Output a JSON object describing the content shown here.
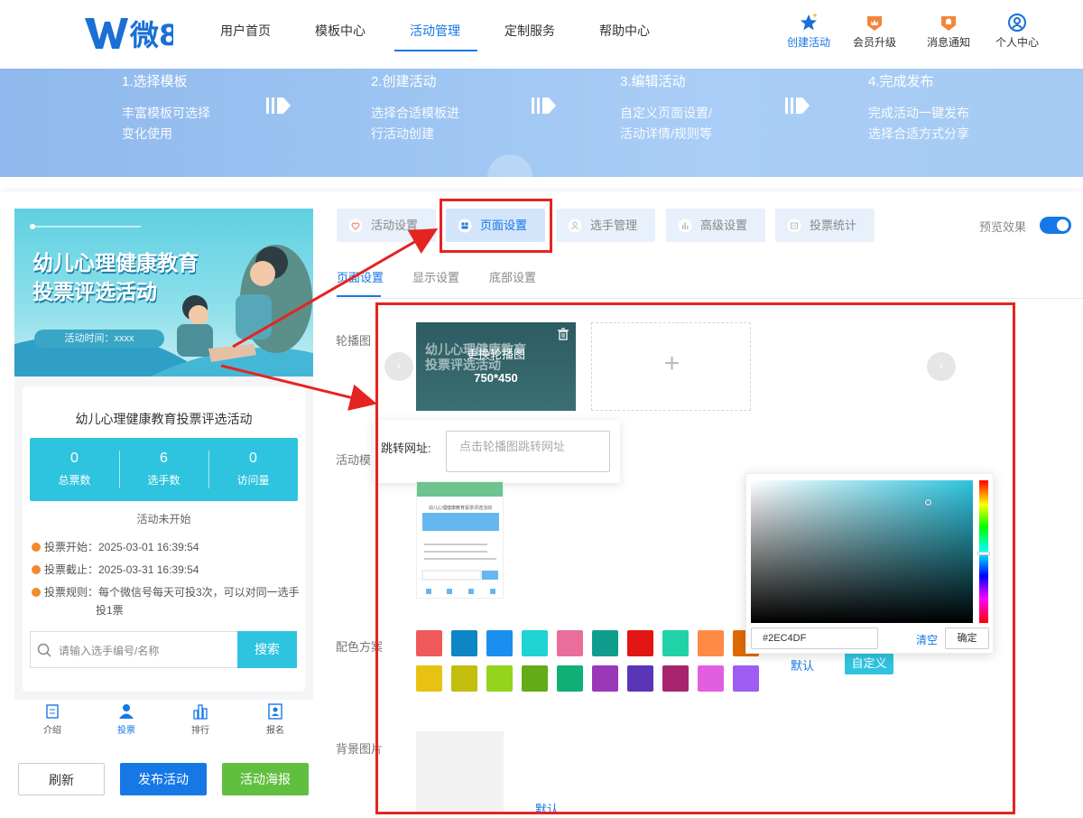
{
  "header": {
    "logo_text": "微8",
    "nav": [
      "用户首页",
      "模板中心",
      "活动管理",
      "定制服务",
      "帮助中心"
    ],
    "active_nav": "活动管理",
    "right_nav": [
      {
        "label": "创建活动",
        "icon": "star-icon"
      },
      {
        "label": "会员升级",
        "icon": "crown-badge-icon"
      },
      {
        "label": "消息通知",
        "icon": "bell-badge-icon"
      },
      {
        "label": "个人中心",
        "icon": "user-icon"
      }
    ]
  },
  "steps": [
    {
      "title": "1.选择模板",
      "desc1": "丰富模板可选择",
      "desc2": "变化使用"
    },
    {
      "title": "2.创建活动",
      "desc1": "选择合适模板进",
      "desc2": "行活动创建"
    },
    {
      "title": "3.编辑活动",
      "desc1": "自定义页面设置/",
      "desc2": "活动详情/规则等"
    },
    {
      "title": "4.完成发布",
      "desc1": "完成活动一键发布",
      "desc2": "选择合适方式分享"
    }
  ],
  "preview": {
    "hero_title_line1": "幼儿心理健康教育",
    "hero_title_line2": "投票评选活动",
    "hero_time": "活动时间：xxxx",
    "activity_title": "幼儿心理健康教育投票评选活动",
    "stats": [
      {
        "value": "0",
        "label": "总票数"
      },
      {
        "value": "6",
        "label": "选手数"
      },
      {
        "value": "0",
        "label": "访问量"
      }
    ],
    "status": "活动未开始",
    "vote_start": "投票开始：2025-03-01 16:39:54",
    "vote_end": "投票截止：2025-03-31 16:39:54",
    "vote_rule_line1": "投票规则：每个微信号每天可投3次，可以对同一选手",
    "vote_rule_line2": "投1票",
    "search_placeholder": "请输入选手编号/名称",
    "search_button": "搜索",
    "tabbar": [
      {
        "label": "介绍",
        "icon": "document-icon"
      },
      {
        "label": "投票",
        "icon": "person-icon"
      },
      {
        "label": "排行",
        "icon": "building-icon"
      },
      {
        "label": "报名",
        "icon": "signup-icon"
      }
    ]
  },
  "actions": {
    "refresh": "刷新",
    "publish": "发布活动",
    "poster": "活动海报"
  },
  "panel_tabs": [
    {
      "label": "活动设置",
      "icon": "heart-shield-icon"
    },
    {
      "label": "页面设置",
      "icon": "layout-icon"
    },
    {
      "label": "选手管理",
      "icon": "people-icon"
    },
    {
      "label": "高级设置",
      "icon": "chart-bars-icon"
    },
    {
      "label": "投票统计",
      "icon": "stats-icon"
    }
  ],
  "active_panel_tab": "页面设置",
  "preview_toggle_label": "预览效果",
  "preview_toggle_on": true,
  "sub_tabs": [
    "页面设置",
    "显示设置",
    "底部设置"
  ],
  "form": {
    "carousel_label": "轮播图",
    "carousel_replace": "更换轮播图",
    "carousel_size": "750*450",
    "link_label": "跳转网址:",
    "link_placeholder": "点击轮播图跳转网址",
    "template_label": "活动模",
    "color_label": "配色方案",
    "color_default": "默认",
    "color_custom": "自定义",
    "bg_label": "背景图片",
    "bg_default": "默认"
  },
  "swatches": [
    "#f05a5a",
    "#0e86c6",
    "#1a8ff0",
    "#1ed3d0",
    "#ea6e9c",
    "#0f9e8e",
    "#e31515",
    "#20d2a5",
    "#ff8a45",
    "#e06a00",
    "#e8c213",
    "#c3bd10",
    "#95d31e",
    "#63ab17",
    "#0faf76",
    "#9a38b8",
    "#5a35b8",
    "#a8246e",
    "#e25ee0",
    "#9d5cf2"
  ],
  "color_picker": {
    "hex": "#2EC4DF",
    "clear": "清空",
    "confirm": "确定"
  },
  "colors": {
    "accent": "#1677e6",
    "theme": "#2ec4df",
    "annotation_red": "#e52421",
    "poster_green": "#61bf40"
  }
}
